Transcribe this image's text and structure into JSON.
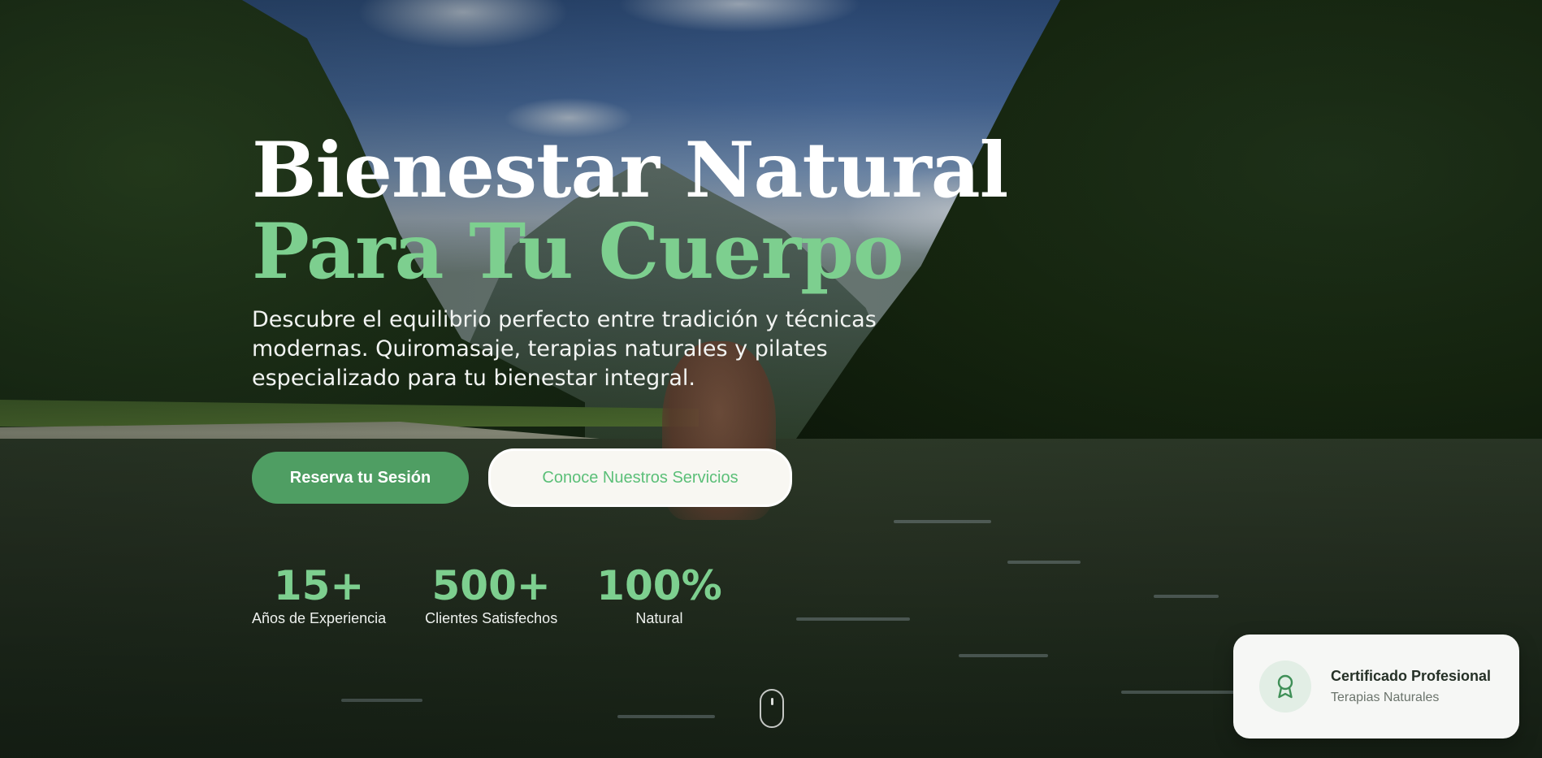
{
  "hero": {
    "title_line1": "Bienestar Natural",
    "title_line2": "Para Tu Cuerpo",
    "subtitle": "Descubre el equilibrio perfecto entre tradición y técnicas modernas. Quiromasaje, terapias naturales y pilates especializado para tu bienestar integral.",
    "primary_cta": "Reserva tu Sesión",
    "secondary_cta": "Conoce Nuestros Servicios",
    "stats": [
      {
        "value": "15+",
        "label": "Años de Experiencia"
      },
      {
        "value": "500+",
        "label": "Clientes Satisfechos"
      },
      {
        "value": "100%",
        "label": "Natural"
      }
    ]
  },
  "certificate": {
    "title": "Certificado Profesional",
    "subtitle": "Terapias Naturales",
    "icon": "award-icon"
  },
  "scroll": {
    "icon": "mouse-scroll-icon"
  },
  "colors": {
    "accent_green": "#7dcf8f",
    "button_green": "#4f9e63",
    "card_bg": "#f6f7f5"
  }
}
